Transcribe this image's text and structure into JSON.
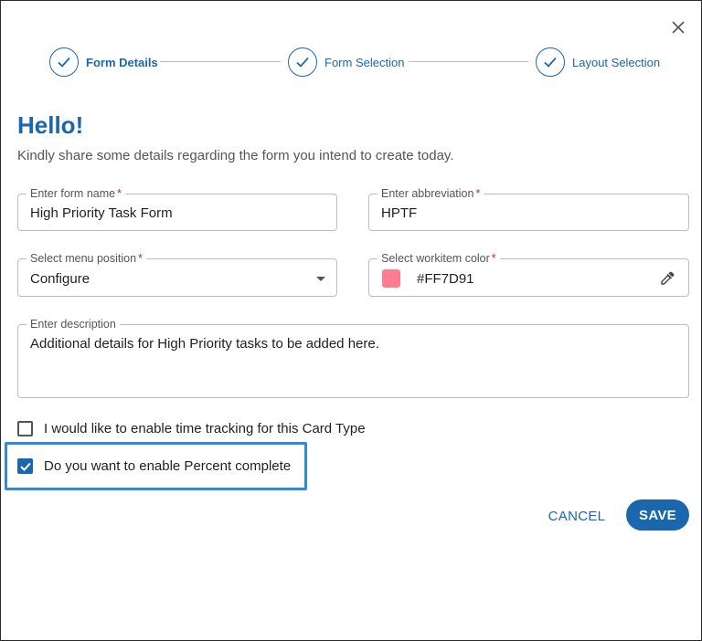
{
  "stepper": {
    "steps": [
      {
        "label": "Form Details",
        "state": "completed",
        "active": true
      },
      {
        "label": "Form Selection",
        "state": "completed",
        "active": false
      },
      {
        "label": "Layout Selection",
        "state": "completed",
        "active": false
      }
    ]
  },
  "header": {
    "title": "Hello!",
    "subtitle": "Kindly share some details regarding the form you intend to create today."
  },
  "form": {
    "form_name": {
      "label": "Enter form name",
      "required_mark": "*",
      "value": "High Priority Task Form"
    },
    "abbreviation": {
      "label": "Enter abbreviation",
      "required_mark": "*",
      "value": "HPTF"
    },
    "menu_position": {
      "label": "Select menu position",
      "required_mark": "*",
      "value": "Configure"
    },
    "workitem_color": {
      "label": "Select workitem color",
      "required_mark": "*",
      "value": "#FF7D91",
      "swatch_color": "#FF7D91"
    },
    "description": {
      "label": "Enter description",
      "value": "Additional details for High Priority tasks to be added here."
    }
  },
  "options": {
    "time_tracking": {
      "label": "I would like to enable time tracking for this Card Type",
      "checked": false
    },
    "percent_complete": {
      "label": "Do you want to enable Percent complete",
      "checked": true
    }
  },
  "actions": {
    "cancel_label": "CANCEL",
    "save_label": "SAVE"
  },
  "colors": {
    "accent": "#1a67ad",
    "highlight": "#2a8be0",
    "required": "#c62828"
  },
  "icons": {
    "close": "close-icon",
    "step_check": "checkmark-icon",
    "dropdown": "caret-down-icon",
    "picker": "eyedropper-icon",
    "checkbox_check": "checkmark-icon"
  }
}
